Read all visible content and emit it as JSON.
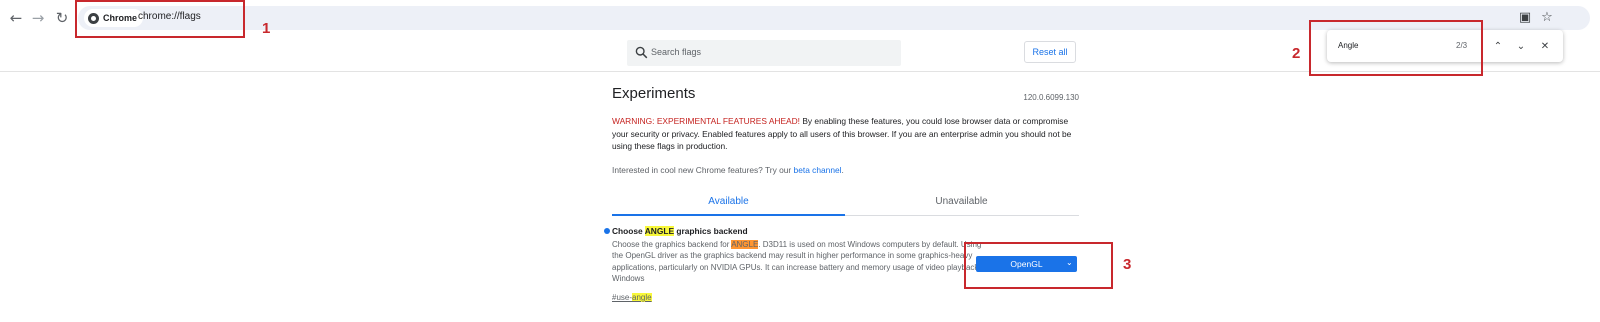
{
  "toolbar": {
    "back_icon": "←",
    "forward_icon": "→",
    "reload_icon": "↻",
    "chip_label": "Chrome",
    "url": "chrome://flags",
    "page_info_icon": "▣",
    "star_icon": "☆"
  },
  "header": {
    "search_placeholder": "Search flags",
    "reset_label": "Reset all"
  },
  "find_bar": {
    "query": "Angle",
    "count": "2/3",
    "prev_icon": "⌃",
    "next_icon": "⌄",
    "close_icon": "✕"
  },
  "main": {
    "title": "Experiments",
    "version": "120.0.6099.130",
    "warning_red": "WARNING: EXPERIMENTAL FEATURES AHEAD!",
    "warning_rest": " By enabling these features, you could lose browser data or compromise your security or privacy. Enabled features apply to all users of this browser. If you are an enterprise admin you should not be using these flags in production.",
    "interest_text": "Interested in cool new Chrome features? Try our ",
    "interest_link": "beta channel",
    "interest_end": ".",
    "tabs": [
      {
        "label": "Available",
        "active": true
      },
      {
        "label": "Unavailable",
        "active": false
      }
    ]
  },
  "experiment": {
    "title_before": "Choose ",
    "title_highlight": "ANGLE",
    "title_after": " graphics backend",
    "desc_before": "Choose the graphics backend for ",
    "desc_highlight": "ANGLE",
    "desc_after": ". D3D11 is used on most Windows computers by default. Using the OpenGL driver as the graphics backend may result in higher performance in some graphics-heavy applications, particularly on NVIDIA GPUs. It can increase battery and memory usage of video playback. – Windows",
    "link_before": "#use-",
    "link_highlight": "angle",
    "selected_option": "OpenGL",
    "caret_icon": "⌄"
  },
  "annotations": [
    {
      "number": "1",
      "color": "#c8282d"
    },
    {
      "number": "2",
      "color": "#c8282d"
    },
    {
      "number": "3",
      "color": "#c8282d"
    }
  ],
  "colors": {
    "accent": "#1a73e8",
    "warning": "#c5221f",
    "highlight": "#f8f83a",
    "highlight_active": "#ff9632",
    "annotation": "#c8282d"
  }
}
